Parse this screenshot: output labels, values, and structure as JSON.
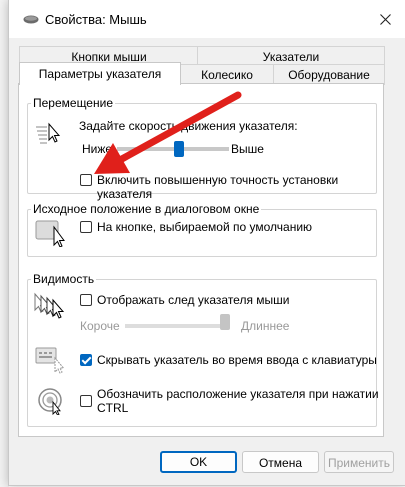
{
  "window": {
    "title": "Свойства: Мышь"
  },
  "tabs": {
    "row1": [
      "Кнопки мыши",
      "Указатели"
    ],
    "row2": [
      "Параметры указателя",
      "Колесико",
      "Оборудование"
    ],
    "active": "Параметры указателя"
  },
  "motion": {
    "title": "Перемещение",
    "speed_label": "Задайте скорость движения указателя:",
    "slow": "Ниже",
    "fast": "Выше",
    "speed_level": 0.55,
    "precision_label": "Включить повышенную точность установки указателя",
    "precision_checked": false
  },
  "snap_to": {
    "title": "Исходное положение в диалоговом окне",
    "label": "На кнопке, выбираемой по умолчанию",
    "checked": false
  },
  "visibility": {
    "title": "Видимость",
    "trails_label": "Отображать след указателя мыши",
    "trails_checked": false,
    "short": "Короче",
    "long": "Длиннее",
    "trail_length_level": 1.0,
    "hide_label": "Скрывать указатель во время ввода с клавиатуры",
    "hide_checked": true,
    "ctrl_label_line1": "Обозначить расположение указателя при нажатии",
    "ctrl_label_line2": "CTRL",
    "ctrl_checked": false
  },
  "buttons": {
    "ok": "OK",
    "cancel": "Отмена",
    "apply": "Применить"
  },
  "colors": {
    "accent": "#0067c0",
    "arrow": "#e0201b"
  }
}
